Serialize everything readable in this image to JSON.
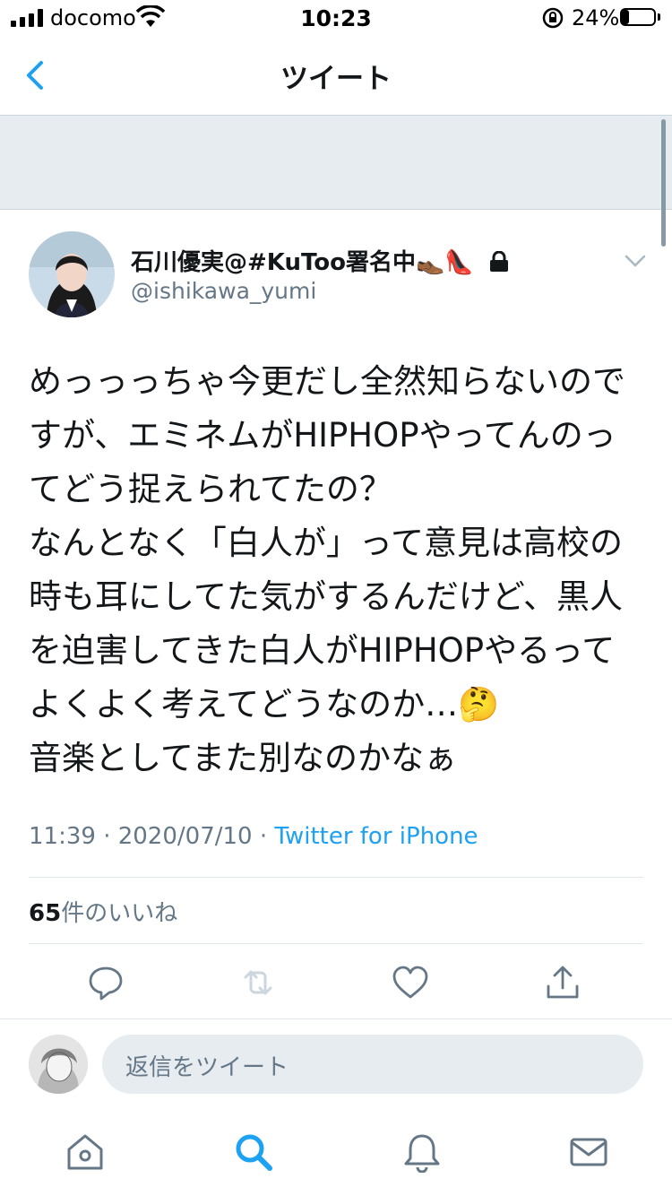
{
  "status_bar": {
    "carrier": "docomo",
    "time": "10:23",
    "battery": "24%"
  },
  "nav": {
    "title": "ツイート"
  },
  "author": {
    "name": "石川優実@#KuToo署名中",
    "name_emojis": "👞👠",
    "handle": "@ishikawa_yumi",
    "protected_icon": "lock-icon"
  },
  "tweet": {
    "text": "めっっっちゃ今更だし全然知らないのですが、エミネムがHIPHOPやってんのってどう捉えられてたの？\nなんとなく「白人が」って意見は高校の時も耳にしてた気がするんだけど、黒人を迫害してきた白人がHIPHOPやるってよくよく考えてどうなのか…🤔\n音楽としてまた別なのかなぁ",
    "time": "11:39 · 2020/07/10 · ",
    "source": "Twitter for iPhone"
  },
  "stats": {
    "likes_count": "65",
    "likes_label": "件のいいね"
  },
  "actions": [
    "reply-icon",
    "retweet-icon",
    "like-icon",
    "share-icon"
  ],
  "reply": {
    "placeholder": "返信をツイート"
  },
  "tabbar": [
    "home-icon",
    "search-icon",
    "notifications-icon",
    "messages-icon"
  ],
  "colors": {
    "accent": "#1da1f2",
    "secondary_text": "#657786",
    "divider": "#e1e8ed"
  }
}
